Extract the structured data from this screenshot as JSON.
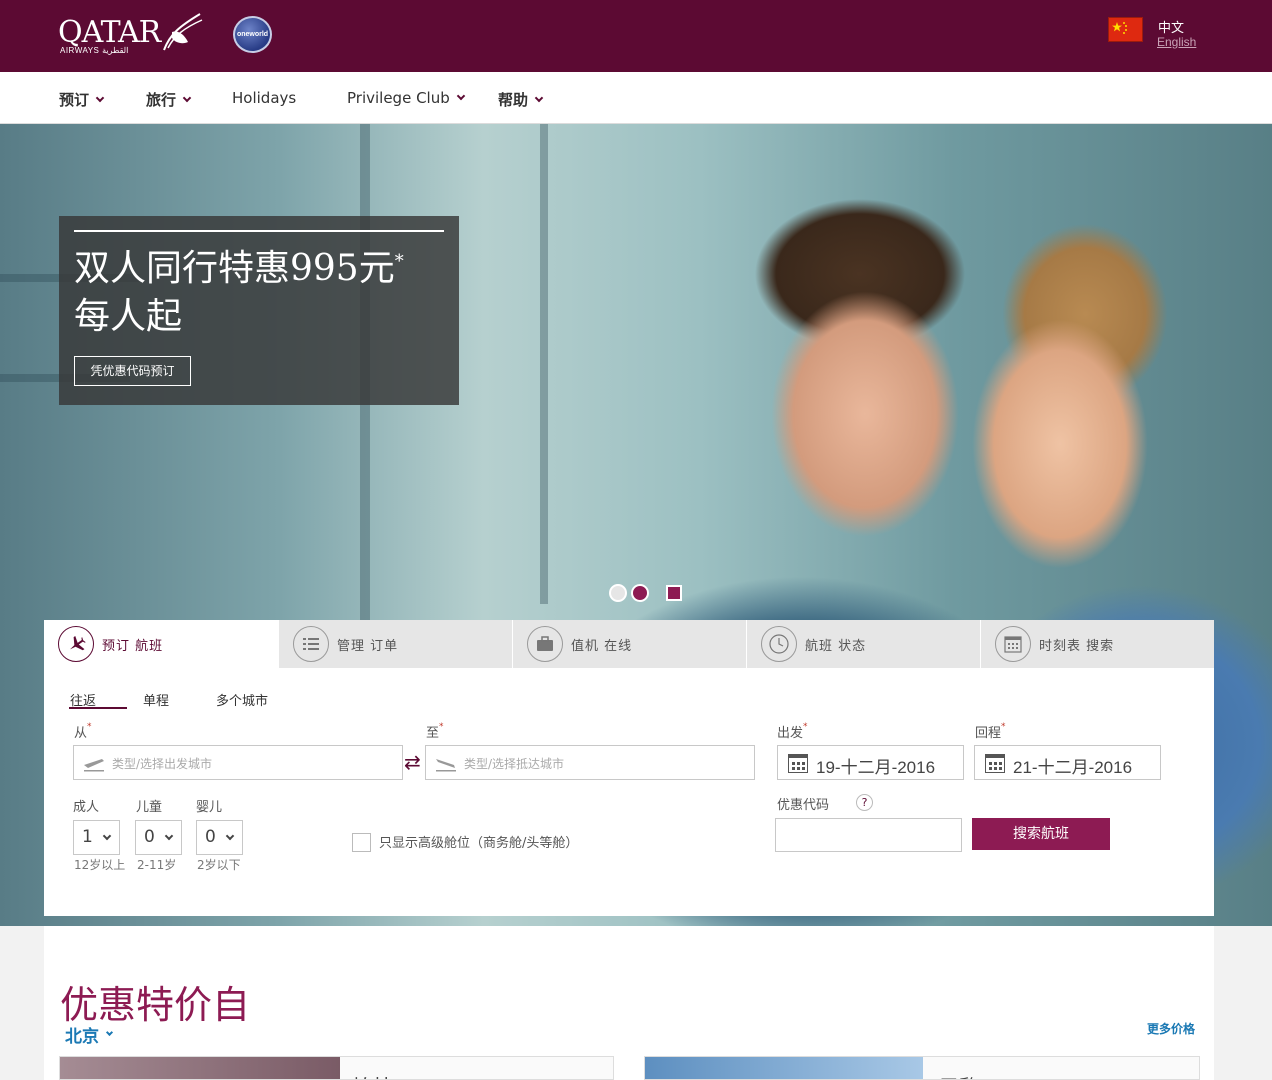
{
  "header": {
    "logo_text": "QATAR",
    "logo_sub": "AIRWAYS القطرية",
    "oneworld_text": "oneworld",
    "lang_current": "中文",
    "lang_alt": "English"
  },
  "nav": {
    "items": [
      {
        "label": "预订"
      },
      {
        "label": "旅行"
      },
      {
        "label": "Holidays"
      },
      {
        "label": "Privilege Club"
      },
      {
        "label": "帮助"
      }
    ]
  },
  "hero": {
    "promo_line1": "双人同行特惠995元",
    "promo_star": "*",
    "promo_line2": "每人起",
    "promo_button": "凭优惠代码预订"
  },
  "booking": {
    "tabs": [
      {
        "label": "预订 航班",
        "icon": "plane-icon"
      },
      {
        "label": "管理 订单",
        "icon": "list-icon"
      },
      {
        "label": "值机 在线",
        "icon": "briefcase-icon"
      },
      {
        "label": "航班 状态",
        "icon": "clock-icon"
      },
      {
        "label": "时刻表 搜索",
        "icon": "calendar-icon"
      }
    ],
    "trip_types": [
      "往返",
      "单程",
      "多个城市"
    ],
    "from_label": "从",
    "to_label": "至",
    "from_placeholder": "类型/选择出发城市",
    "to_placeholder": "类型/选择抵达城市",
    "depart_label": "出发",
    "return_label": "回程",
    "depart_value": "19-十二月-2016",
    "return_value": "21-十二月-2016",
    "adults_label": "成人",
    "children_label": "儿童",
    "infants_label": "婴儿",
    "adults_value": "1",
    "children_value": "0",
    "infants_value": "0",
    "adults_hint": "12岁以上",
    "children_hint": "2-11岁",
    "infants_hint": "2岁以下",
    "premium_label": "只显示高级舱位（商务舱/头等舱）",
    "promo_code_label": "优惠代码",
    "help_glyph": "?",
    "search_button": "搜索航班",
    "required_mark": "*",
    "swap_glyph": "⇄"
  },
  "deals": {
    "title": "优惠特价自",
    "city": "北京",
    "more_link": "更多价格",
    "card1_city": "柏林",
    "card2_city": "巴黎"
  },
  "colors": {
    "brand": "#5c0a33",
    "accent": "#8d1b53",
    "link": "#1b79b4"
  }
}
